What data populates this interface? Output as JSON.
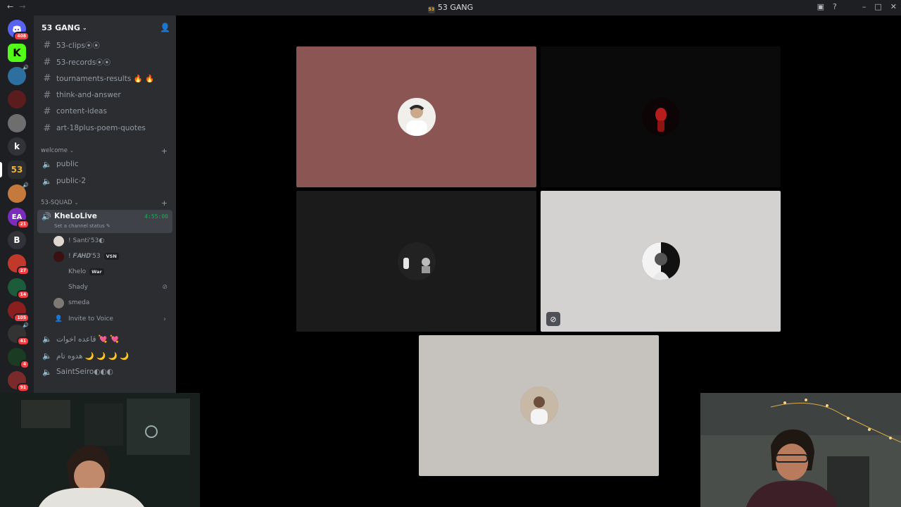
{
  "titlebar": {
    "title": "53 GANG",
    "server_glyph": "53",
    "back_icon": "←",
    "forward_icon": "→",
    "window_controls": [
      "minimize",
      "maximize",
      "close"
    ]
  },
  "server": {
    "name": "53 GANG",
    "invite_icon": "add-friend-icon"
  },
  "guilds": [
    {
      "label": "",
      "badge": "408",
      "color": "#5865f2"
    },
    {
      "label": "K",
      "badge": "",
      "color": "#53fc18"
    },
    {
      "label": "",
      "badge": "",
      "color": "#2d6f9e"
    },
    {
      "label": "",
      "badge": "",
      "color": "#5a1c1c"
    },
    {
      "label": "",
      "badge": "",
      "color": "#6e6e6e"
    },
    {
      "label": "k",
      "badge": "",
      "color": "#313338"
    },
    {
      "label": "53",
      "badge": "",
      "color": "#2b2d31"
    },
    {
      "label": "",
      "badge": "",
      "color": "#c47a3c"
    },
    {
      "label": "EA",
      "badge": "21",
      "color": "#7b2bbd"
    },
    {
      "label": "B",
      "badge": "",
      "color": "#313338"
    },
    {
      "label": "",
      "badge": "27",
      "color": "#c0392b"
    },
    {
      "label": "",
      "badge": "14",
      "color": "#1d5c3a"
    },
    {
      "label": "",
      "badge": "105",
      "color": "#8a1f1f"
    },
    {
      "label": "",
      "badge": "41",
      "color": "#333"
    },
    {
      "label": "",
      "badge": "4",
      "color": "#1b3b22"
    },
    {
      "label": "",
      "badge": "91",
      "color": "#7a2a2a"
    }
  ],
  "channels_top": [
    {
      "name": "53-clips⦿⦿"
    },
    {
      "name": "53-records⦿⦿"
    },
    {
      "name": "tournaments-results 🔥 🔥"
    },
    {
      "name": "think-and-answer"
    },
    {
      "name": "content-ideas"
    },
    {
      "name": "art-18plus-poem-quotes"
    }
  ],
  "categories": {
    "welcome": "welcome",
    "squad": "53-SQUAD"
  },
  "voice_welcome": [
    {
      "name": "public"
    },
    {
      "name": "public-2"
    }
  ],
  "active_voice": {
    "name": "KheLoLive",
    "timer": "4:55:00",
    "status_placeholder": "Set a channel status ✎"
  },
  "voice_users": [
    {
      "name": "! Santi'53◐",
      "tag": "",
      "muted": false
    },
    {
      "name": "! 𝑭𝑨𝑯𝑫'53",
      "tag": "VSN",
      "muted": false
    },
    {
      "name": "Khelo",
      "tag": "War",
      "muted": false
    },
    {
      "name": "Shady",
      "tag": "",
      "muted": true
    },
    {
      "name": "smeda",
      "tag": "",
      "muted": false
    }
  ],
  "invite_to_voice": "Invite to Voice",
  "voice_bottom": [
    {
      "name": "قاعده اخوات 💘 💘"
    },
    {
      "name": "هدوه تام 🌙 🌙 🌙 🌙"
    },
    {
      "name": "SaintSeiro◐◐◐"
    }
  ],
  "stage_tiles": [
    {
      "bg": "#8b5553",
      "avatar": "#e8e4df",
      "muted": false
    },
    {
      "bg": "#0a0a0a",
      "avatar": "#120606",
      "muted": false
    },
    {
      "bg": "#1b1b1b",
      "avatar": "#2a2a2a",
      "muted": false
    },
    {
      "bg": "#d4d2d1",
      "avatar": "#111111",
      "muted": true
    },
    {
      "bg": "#c6c2be",
      "avatar": "#8d7a6a",
      "muted": false
    }
  ],
  "colors": {
    "accent": "#5865f2",
    "speaking": "#23a55a",
    "badge": "#f23f43"
  }
}
